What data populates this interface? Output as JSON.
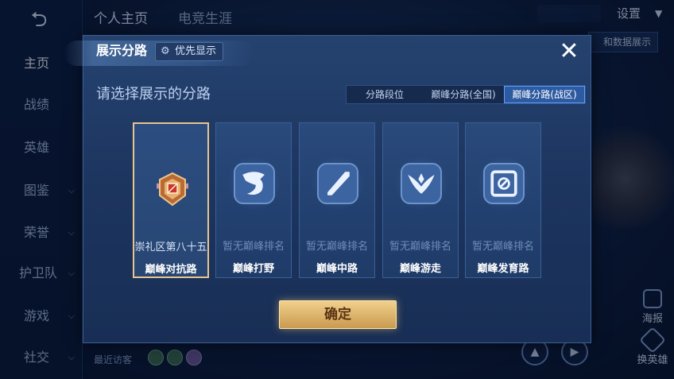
{
  "background": {
    "nav": {
      "items": [
        {
          "label": "主页",
          "has_chevron": false
        },
        {
          "label": "战绩",
          "has_chevron": false
        },
        {
          "label": "英雄",
          "has_chevron": false
        },
        {
          "label": "图鉴",
          "has_chevron": true
        },
        {
          "label": "荣誉",
          "has_chevron": true
        },
        {
          "label": "护卫队",
          "has_chevron": true
        },
        {
          "label": "游戏",
          "has_chevron": true
        },
        {
          "label": "社交",
          "has_chevron": true
        }
      ]
    },
    "tabs": [
      "个人主页",
      "电竞生涯"
    ],
    "settings_label": "设置",
    "data_button_label": "和数据展示",
    "side_buttons": [
      "海报",
      "换英雄"
    ],
    "recent_visitors_label": "最近访客"
  },
  "modal": {
    "title": "展示分路",
    "priority_button": "优先显示",
    "subtitle": "请选择展示的分路",
    "segments": [
      {
        "label": "分路段位",
        "active": false
      },
      {
        "label": "巅峰分路(全国)",
        "active": false
      },
      {
        "label": "巅峰分路(战区)",
        "active": true
      }
    ],
    "cards": [
      {
        "status": "崇礼区第八十五",
        "route": "巅峰对抗路",
        "selected": true,
        "icon": "rank-badge-icon"
      },
      {
        "status": "暂无巅峰排名",
        "route": "巅峰打野",
        "selected": false,
        "icon": "jungle-dragon-icon"
      },
      {
        "status": "暂无巅峰排名",
        "route": "巅峰中路",
        "selected": false,
        "icon": "mid-slash-icon"
      },
      {
        "status": "暂无巅峰排名",
        "route": "巅峰游走",
        "selected": false,
        "icon": "roam-wings-icon"
      },
      {
        "status": "暂无巅峰排名",
        "route": "巅峰发育路",
        "selected": false,
        "icon": "farm-target-icon"
      }
    ],
    "confirm_label": "确定"
  },
  "colors": {
    "accent_gold": "#e8c58f",
    "segment_active": "#2d5aa0",
    "modal_bg": "#1f3b68"
  }
}
